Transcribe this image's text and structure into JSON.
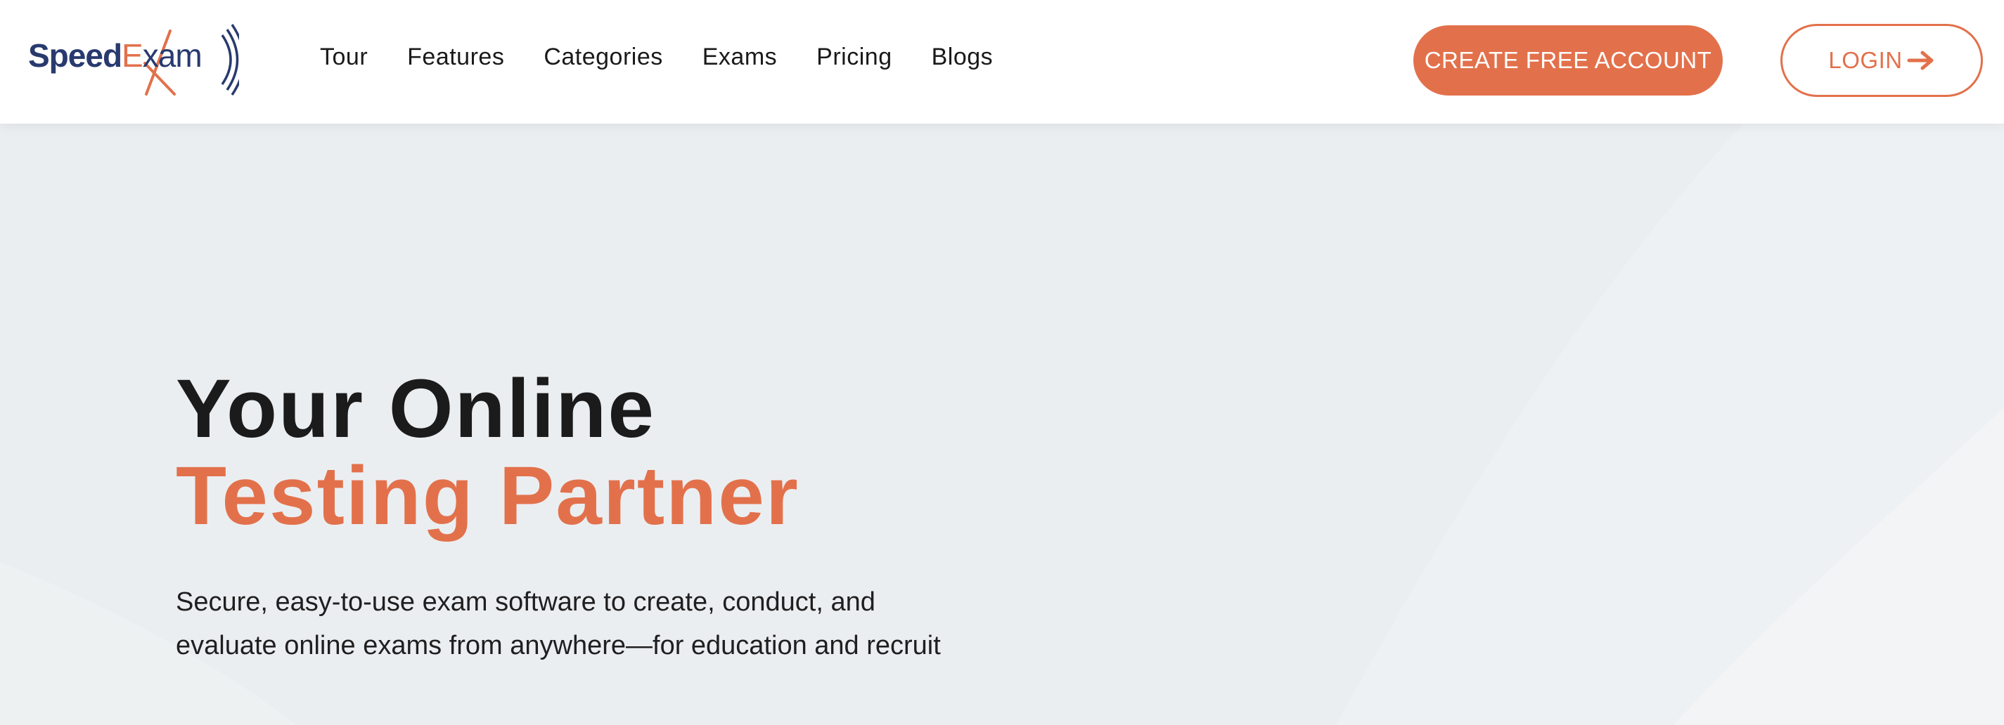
{
  "header": {
    "logo": {
      "speed": "Speed",
      "exam_e": "E",
      "exam_rest": "xam"
    },
    "nav": [
      {
        "label": "Tour"
      },
      {
        "label": "Features"
      },
      {
        "label": "Categories"
      },
      {
        "label": "Exams"
      },
      {
        "label": "Pricing"
      },
      {
        "label": "Blogs"
      }
    ],
    "create_account_label": "CREATE FREE ACCOUNT",
    "login_label": "LOGIN"
  },
  "hero": {
    "title_line1": "Your Online",
    "title_line2": "Testing Partner",
    "description": "Secure, easy-to-use exam software to create, conduct, and evaluate online exams from anywhere—for education and recruit"
  },
  "icons": {
    "login_arrow": "arrow-right-icon",
    "logo_mark": "signal-arcs-icon"
  },
  "colors": {
    "accent": "#e2714b",
    "brand_navy": "#283a6e",
    "background": "#ebeef1",
    "text_dark": "#1b1b1b"
  }
}
